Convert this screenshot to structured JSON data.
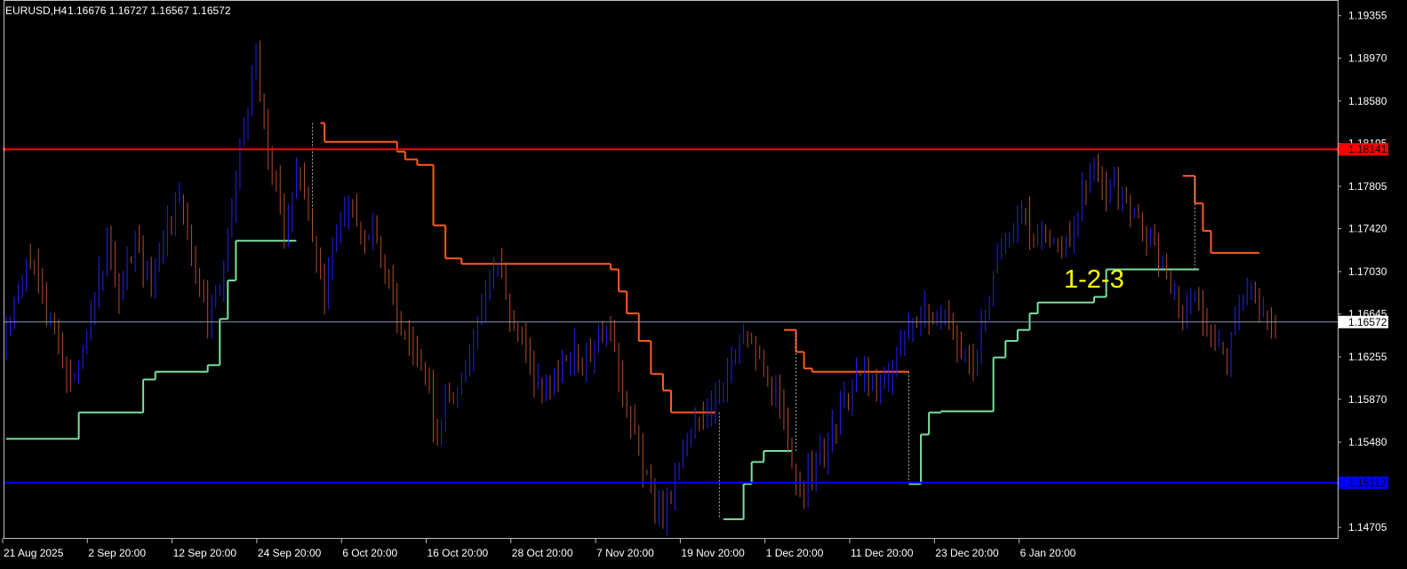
{
  "header": {
    "symbol": "EURUSD,H4",
    "ohlc": "1.16676 1.16727 1.16567 1.16572"
  },
  "annotation": {
    "text": "1-2-3"
  },
  "colors": {
    "background": "#000000",
    "frame": "#c0c0c0",
    "bull_candle": "#2222ee",
    "bear_candle": "#b04c2c",
    "resistance_line": "#ff0000",
    "support_line": "#0000ff",
    "upper_step": "#ff5a1e",
    "lower_step": "#7de0a0",
    "current_price_line": "#8a9aa8",
    "annotation": "#ffff00",
    "text": "#ffffff"
  },
  "chart_data": {
    "type": "candlestick",
    "x_ticks": [
      "21 Aug 2025",
      "2 Sep 20:00",
      "12 Sep 20:00",
      "24 Sep 20:00",
      "6 Oct 20:00",
      "16 Oct 20:00",
      "28 Oct 20:00",
      "7 Nov 20:00",
      "19 Nov 20:00",
      "1 Dec 20:00",
      "11 Dec 20:00",
      "23 Dec 20:00",
      "6 Jan 20:00"
    ],
    "y_ticks": [
      "1.19355",
      "1.18970",
      "1.18580",
      "1.18195",
      "1.17805",
      "1.17420",
      "1.17030",
      "1.16645",
      "1.16255",
      "1.15870",
      "1.15480",
      "1.15090",
      "1.14705"
    ],
    "ylim": [
      1.1461,
      1.1949
    ],
    "current_price": {
      "value": 1.16572,
      "label": "1.16572"
    },
    "horizontal_lines": [
      {
        "value": 1.18141,
        "label": "1.18141"
      },
      {
        "value": 1.15112,
        "label": "1.15112"
      }
    ],
    "price_path_points": [
      [
        0,
        1.1635
      ],
      [
        6,
        1.172
      ],
      [
        11,
        1.167
      ],
      [
        17,
        1.1598
      ],
      [
        22,
        1.166
      ],
      [
        26,
        1.1725
      ],
      [
        29,
        1.168
      ],
      [
        33,
        1.173
      ],
      [
        37,
        1.169
      ],
      [
        41,
        1.175
      ],
      [
        44,
        1.1765
      ],
      [
        48,
        1.171
      ],
      [
        51,
        1.1665
      ],
      [
        55,
        1.17
      ],
      [
        58,
        1.179
      ],
      [
        61,
        1.186
      ],
      [
        63,
        1.1895
      ],
      [
        65,
        1.183
      ],
      [
        68,
        1.178
      ],
      [
        70,
        1.174
      ],
      [
        73,
        1.18
      ],
      [
        76,
        1.176
      ],
      [
        80,
        1.168
      ],
      [
        83,
        1.174
      ],
      [
        86,
        1.177
      ],
      [
        89,
        1.173
      ],
      [
        92,
        1.175
      ],
      [
        95,
        1.17
      ],
      [
        99,
        1.165
      ],
      [
        103,
        1.163
      ],
      [
        106,
        1.159
      ],
      [
        108,
        1.1545
      ],
      [
        110,
        1.1585
      ],
      [
        114,
        1.16
      ],
      [
        117,
        1.1645
      ],
      [
        120,
        1.169
      ],
      [
        123,
        1.171
      ],
      [
        126,
        1.1665
      ],
      [
        129,
        1.164
      ],
      [
        132,
        1.1605
      ],
      [
        136,
        1.159
      ],
      [
        139,
        1.162
      ],
      [
        142,
        1.1635
      ],
      [
        145,
        1.162
      ],
      [
        148,
        1.165
      ],
      [
        151,
        1.164
      ],
      [
        154,
        1.16
      ],
      [
        157,
        1.155
      ],
      [
        160,
        1.1515
      ],
      [
        162,
        1.149
      ],
      [
        164,
        1.1478
      ],
      [
        166,
        1.15
      ],
      [
        169,
        1.1535
      ],
      [
        172,
        1.1565
      ],
      [
        175,
        1.158
      ],
      [
        178,
        1.16
      ],
      [
        181,
        1.162
      ],
      [
        184,
        1.1645
      ],
      [
        187,
        1.163
      ],
      [
        190,
        1.16
      ],
      [
        193,
        1.158
      ],
      [
        196,
        1.152
      ],
      [
        199,
        1.151
      ],
      [
        202,
        1.153
      ],
      [
        205,
        1.1545
      ],
      [
        208,
        1.1575
      ],
      [
        211,
        1.16
      ],
      [
        214,
        1.1615
      ],
      [
        217,
        1.159
      ],
      [
        220,
        1.1605
      ],
      [
        223,
        1.1635
      ],
      [
        226,
        1.166
      ],
      [
        229,
        1.167
      ],
      [
        232,
        1.165
      ],
      [
        235,
        1.1655
      ],
      [
        238,
        1.163
      ],
      [
        241,
        1.162
      ],
      [
        244,
        1.166
      ],
      [
        247,
        1.171
      ],
      [
        250,
        1.174
      ],
      [
        253,
        1.176
      ],
      [
        256,
        1.173
      ],
      [
        259,
        1.1745
      ],
      [
        262,
        1.172
      ],
      [
        265,
        1.1735
      ],
      [
        268,
        1.177
      ],
      [
        271,
        1.1795
      ],
      [
        274,
        1.178
      ],
      [
        277,
        1.1775
      ],
      [
        280,
        1.176
      ],
      [
        283,
        1.174
      ],
      [
        286,
        1.172
      ],
      [
        289,
        1.17
      ],
      [
        292,
        1.1665
      ],
      [
        295,
        1.168
      ],
      [
        298,
        1.166
      ],
      [
        301,
        1.164
      ],
      [
        304,
        1.162
      ],
      [
        307,
        1.1675
      ],
      [
        310,
        1.1685
      ],
      [
        313,
        1.166
      ],
      [
        315,
        1.1658
      ]
    ],
    "upper_step_segments": [
      {
        "from": 78,
        "to": 79,
        "value": 1.1838
      },
      {
        "from": 79,
        "to": 97,
        "value": 1.1821
      },
      {
        "from": 97,
        "to": 99,
        "value": 1.1812
      },
      {
        "from": 99,
        "to": 102,
        "value": 1.1805
      },
      {
        "from": 102,
        "to": 106,
        "value": 1.18
      },
      {
        "from": 106,
        "to": 109,
        "value": 1.1745
      },
      {
        "from": 109,
        "to": 113,
        "value": 1.1715
      },
      {
        "from": 113,
        "to": 150,
        "value": 1.171
      },
      {
        "from": 150,
        "to": 152,
        "value": 1.1705
      },
      {
        "from": 152,
        "to": 154,
        "value": 1.1685
      },
      {
        "from": 154,
        "to": 157,
        "value": 1.1665
      },
      {
        "from": 157,
        "to": 160,
        "value": 1.164
      },
      {
        "from": 160,
        "to": 163,
        "value": 1.161
      },
      {
        "from": 163,
        "to": 165,
        "value": 1.1595
      },
      {
        "from": 165,
        "to": 176,
        "value": 1.1575
      },
      {
        "from": 193,
        "to": 196,
        "value": 1.165
      },
      {
        "from": 196,
        "to": 198,
        "value": 1.163
      },
      {
        "from": 198,
        "to": 200,
        "value": 1.1615
      },
      {
        "from": 200,
        "to": 224,
        "value": 1.1612
      },
      {
        "from": 292,
        "to": 295,
        "value": 1.179
      },
      {
        "from": 295,
        "to": 297,
        "value": 1.1765
      },
      {
        "from": 297,
        "to": 299,
        "value": 1.174
      },
      {
        "from": 299,
        "to": 311,
        "value": 1.172
      }
    ],
    "lower_step_segments": [
      {
        "from": 0,
        "to": 18,
        "value": 1.1551
      },
      {
        "from": 18,
        "to": 34,
        "value": 1.1575
      },
      {
        "from": 34,
        "to": 37,
        "value": 1.1605
      },
      {
        "from": 37,
        "to": 50,
        "value": 1.1612
      },
      {
        "from": 50,
        "to": 53,
        "value": 1.1618
      },
      {
        "from": 53,
        "to": 55,
        "value": 1.166
      },
      {
        "from": 55,
        "to": 57,
        "value": 1.1695
      },
      {
        "from": 57,
        "to": 72,
        "value": 1.1731
      },
      {
        "from": 178,
        "to": 183,
        "value": 1.1478
      },
      {
        "from": 183,
        "to": 185,
        "value": 1.151
      },
      {
        "from": 185,
        "to": 188,
        "value": 1.153
      },
      {
        "from": 188,
        "to": 195,
        "value": 1.154
      },
      {
        "from": 224,
        "to": 227,
        "value": 1.151
      },
      {
        "from": 227,
        "to": 229,
        "value": 1.1555
      },
      {
        "from": 229,
        "to": 232,
        "value": 1.1575
      },
      {
        "from": 232,
        "to": 245,
        "value": 1.1576
      },
      {
        "from": 245,
        "to": 248,
        "value": 1.1625
      },
      {
        "from": 248,
        "to": 251,
        "value": 1.164
      },
      {
        "from": 251,
        "to": 254,
        "value": 1.165
      },
      {
        "from": 254,
        "to": 256,
        "value": 1.1665
      },
      {
        "from": 256,
        "to": 270,
        "value": 1.1675
      },
      {
        "from": 270,
        "to": 273,
        "value": 1.168
      },
      {
        "from": 273,
        "to": 296,
        "value": 1.1705
      }
    ],
    "dotted_connectors": [
      {
        "at": 76,
        "from": 1.173,
        "to": 1.1838
      },
      {
        "at": 177,
        "from": 1.1575,
        "to": 1.1478
      },
      {
        "at": 196,
        "from": 1.154,
        "to": 1.165
      },
      {
        "at": 224,
        "from": 1.1612,
        "to": 1.151
      },
      {
        "at": 295,
        "from": 1.1705,
        "to": 1.179
      }
    ]
  }
}
